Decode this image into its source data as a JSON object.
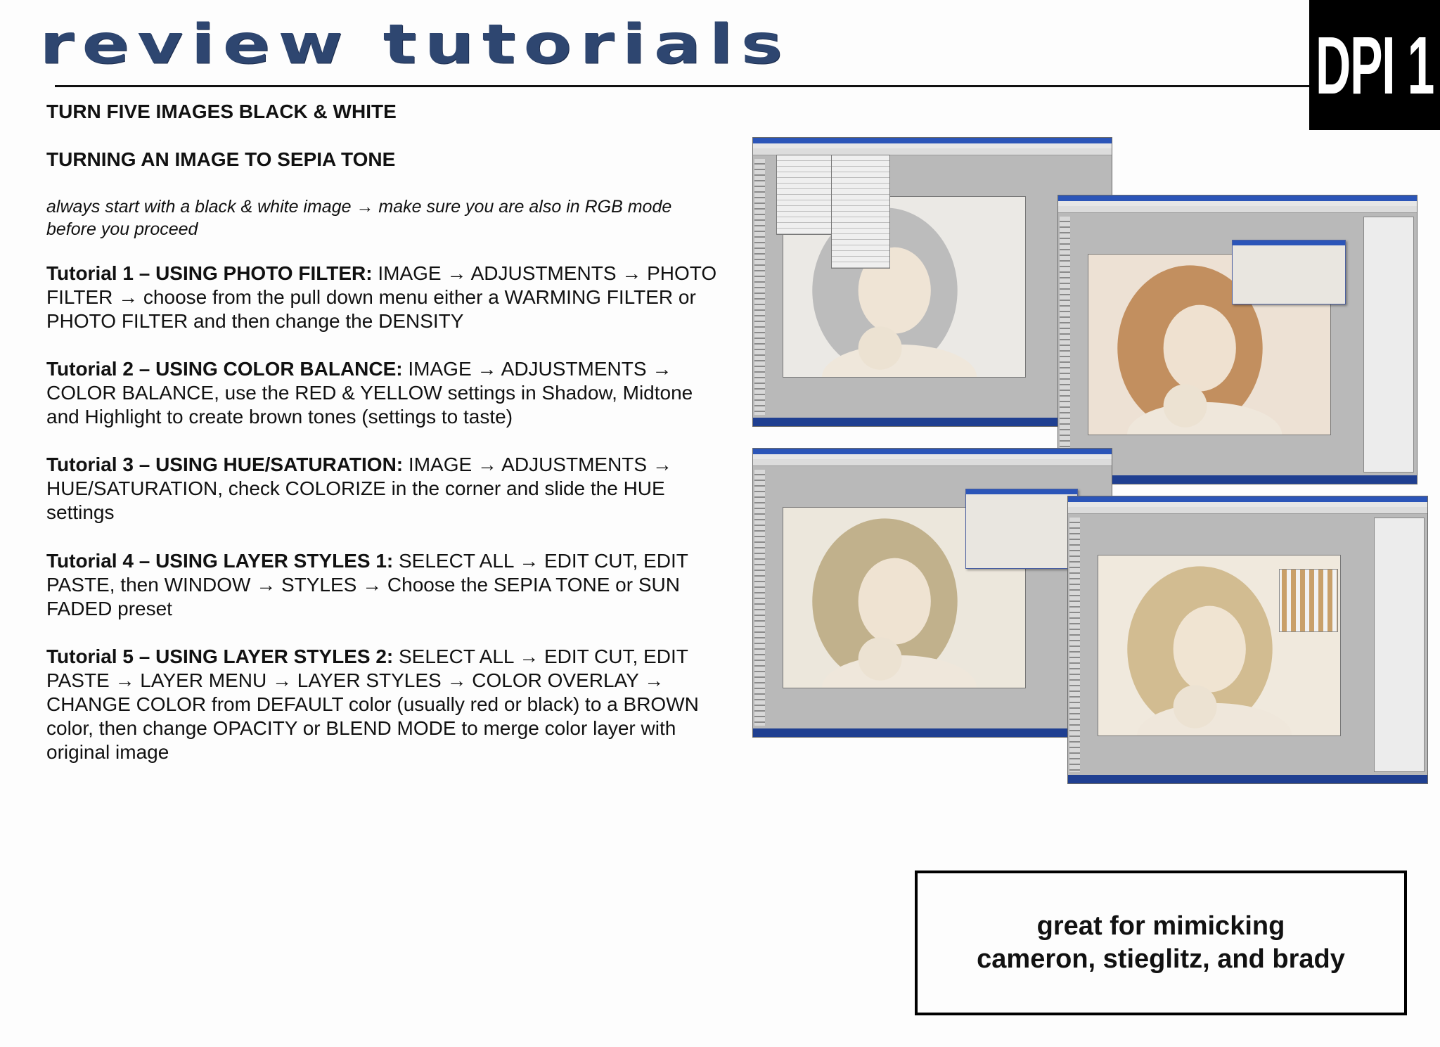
{
  "header": {
    "title": "review tutorials",
    "badge": "DPI 1"
  },
  "headings": {
    "assignment": "TURN FIVE IMAGES BLACK & WHITE",
    "section": "TURNING AN IMAGE TO SEPIA TONE"
  },
  "intro": "always start with a black & white image → make sure you are also in RGB mode before you proceed",
  "tutorials": [
    {
      "title": "Tutorial 1 – USING PHOTO FILTER:",
      "body": " IMAGE → ADJUSTMENTS → PHOTO FILTER → choose from the pull down menu either a WARMING FILTER or PHOTO FILTER and then change the DENSITY"
    },
    {
      "title": "Tutorial 2 – USING COLOR BALANCE:",
      "body": " IMAGE → ADJUSTMENTS → COLOR BALANCE, use the RED & YELLOW settings in Shadow, Midtone and Highlight to create brown tones (settings to taste)"
    },
    {
      "title": "Tutorial 3 – USING HUE/SATURATION:",
      "body": " IMAGE → ADJUSTMENTS → HUE/SATURATION, check COLORIZE in the corner and slide the HUE settings"
    },
    {
      "title": "Tutorial 4 – USING LAYER STYLES 1:",
      "body": " SELECT ALL → EDIT CUT, EDIT PASTE, then WINDOW → STYLES → Choose the SEPIA TONE or SUN FADED preset"
    },
    {
      "title": "Tutorial 5 – USING LAYER STYLES 2:",
      "body": " SELECT ALL → EDIT CUT, EDIT PASTE → LAYER MENU → LAYER STYLES → COLOR OVERLAY → CHANGE COLOR from DEFAULT color (usually red or black) to a BROWN color, then change OPACITY or BLEND MODE to merge color layer with original image"
    }
  ],
  "note": {
    "line1": "great for mimicking",
    "line2": "cameron, stieglitz, and brady"
  },
  "screenshots": [
    {
      "name": "grayscale-menu",
      "tone": "#b9b9b9"
    },
    {
      "name": "photo-filter",
      "tone": "#c08a58"
    },
    {
      "name": "hue-saturation",
      "tone": "#bfae87"
    },
    {
      "name": "layer-styles",
      "tone": "#d0b98c"
    }
  ]
}
